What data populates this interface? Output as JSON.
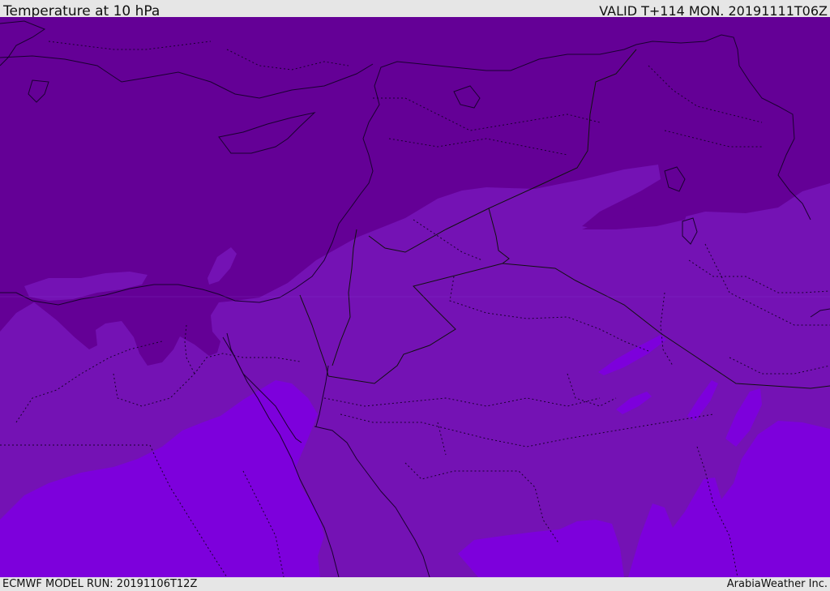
{
  "header": {
    "title": "Temperature at 10 hPa",
    "valid": "VALID T+114 MON. 20191111T06Z"
  },
  "footer": {
    "model_run": "ECMWF MODEL RUN: 20191106T12Z",
    "brand": "ArabiaWeather Inc."
  },
  "colors": {
    "band_dark": "#640096",
    "band_mid": "#7412b4",
    "band_light": "#7d00dc",
    "border_line": "#1a0030",
    "bar_bg": "#e6e6e6"
  },
  "map": {
    "layer": "temperature-shading",
    "features": [
      "coastlines",
      "country-borders",
      "province-borders"
    ]
  }
}
